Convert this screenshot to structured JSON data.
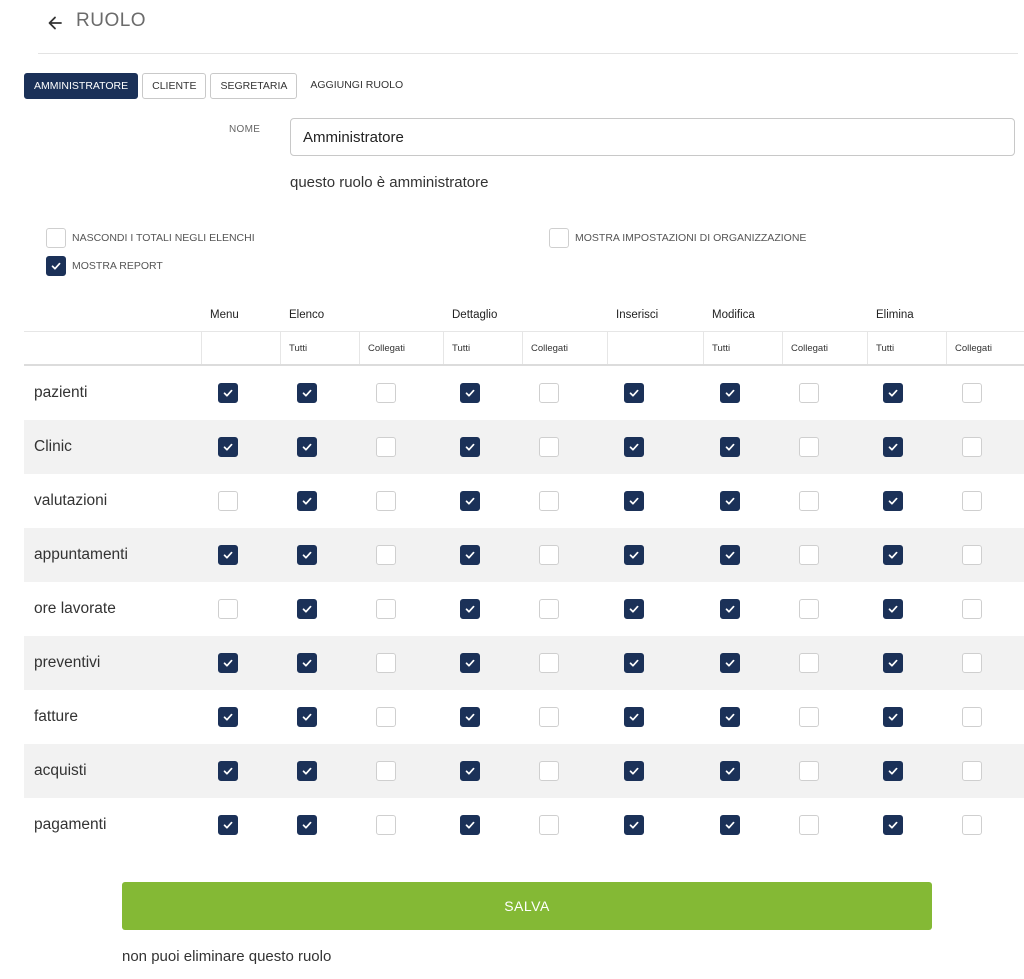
{
  "header": {
    "title": "RUOLO"
  },
  "tabs": [
    {
      "label": "AMMINISTRATORE",
      "active": true
    },
    {
      "label": "CLIENTE",
      "active": false
    },
    {
      "label": "SEGRETARIA",
      "active": false
    },
    {
      "label": "AGGIUNGI RUOLO",
      "active": false
    }
  ],
  "form": {
    "name_label": "NOME",
    "name_value": "Amministratore",
    "admin_note": "questo ruolo è amministratore"
  },
  "options": {
    "hide_totals": {
      "label": "NASCONDI I TOTALI NEGLI ELENCHI",
      "checked": false
    },
    "show_org_settings": {
      "label": "MOSTRA IMPOSTAZIONI DI ORGANIZZAZIONE",
      "checked": false
    },
    "show_report": {
      "label": "MOSTRA REPORT",
      "checked": true
    }
  },
  "table": {
    "groups": [
      "Menu",
      "Elenco",
      "Dettaglio",
      "Inserisci",
      "Modifica",
      "Elimina"
    ],
    "subheaders": {
      "all": "Tutti",
      "linked": "Collegati"
    },
    "rows": [
      {
        "label": "pazienti",
        "perms": [
          true,
          true,
          false,
          true,
          false,
          true,
          true,
          false,
          true,
          false
        ]
      },
      {
        "label": "Clinic",
        "perms": [
          true,
          true,
          false,
          true,
          false,
          true,
          true,
          false,
          true,
          false
        ]
      },
      {
        "label": "valutazioni",
        "perms": [
          false,
          true,
          false,
          true,
          false,
          true,
          true,
          false,
          true,
          false
        ]
      },
      {
        "label": "appuntamenti",
        "perms": [
          true,
          true,
          false,
          true,
          false,
          true,
          true,
          false,
          true,
          false
        ]
      },
      {
        "label": "ore lavorate",
        "perms": [
          false,
          true,
          false,
          true,
          false,
          true,
          true,
          false,
          true,
          false
        ]
      },
      {
        "label": "preventivi",
        "perms": [
          true,
          true,
          false,
          true,
          false,
          true,
          true,
          false,
          true,
          false
        ]
      },
      {
        "label": "fatture",
        "perms": [
          true,
          true,
          false,
          true,
          false,
          true,
          true,
          false,
          true,
          false
        ]
      },
      {
        "label": "acquisti",
        "perms": [
          true,
          true,
          false,
          true,
          false,
          true,
          true,
          false,
          true,
          false
        ]
      },
      {
        "label": "pagamenti",
        "perms": [
          true,
          true,
          false,
          true,
          false,
          true,
          true,
          false,
          true,
          false
        ]
      }
    ]
  },
  "actions": {
    "save_label": "SALVA",
    "delete_note": "non puoi eliminare questo ruolo"
  },
  "colors": {
    "primary": "#1b3158",
    "save": "#84b935"
  }
}
